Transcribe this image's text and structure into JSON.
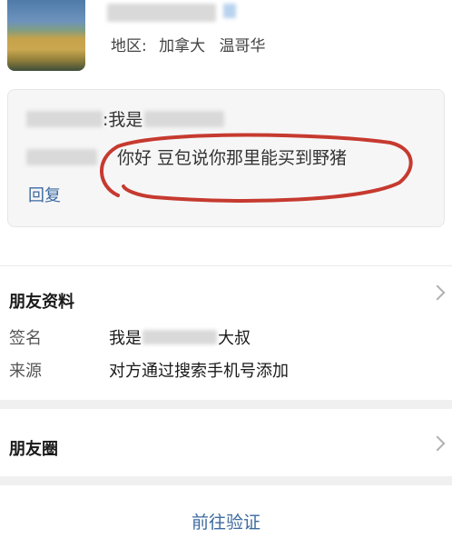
{
  "profile": {
    "region_label": "地区:",
    "region_country": "加拿大",
    "region_city": "温哥华"
  },
  "greeting": {
    "line1_suffix": ":我是",
    "line2_text": "你好 豆包说你那里能买到野猪",
    "reply_label": "回复",
    "highlight_color": "#c63a2f"
  },
  "friend_info": {
    "title": "朋友资料",
    "signature_label": "签名",
    "signature_prefix": "我是",
    "signature_suffix": "大叔",
    "source_label": "来源",
    "source_value": "对方通过搜索手机号添加"
  },
  "moments": {
    "title": "朋友圈"
  },
  "footer": {
    "verify_label": "前往验证"
  },
  "colors": {
    "link": "#3c6aa0",
    "box_bg": "#f6f6f7"
  }
}
